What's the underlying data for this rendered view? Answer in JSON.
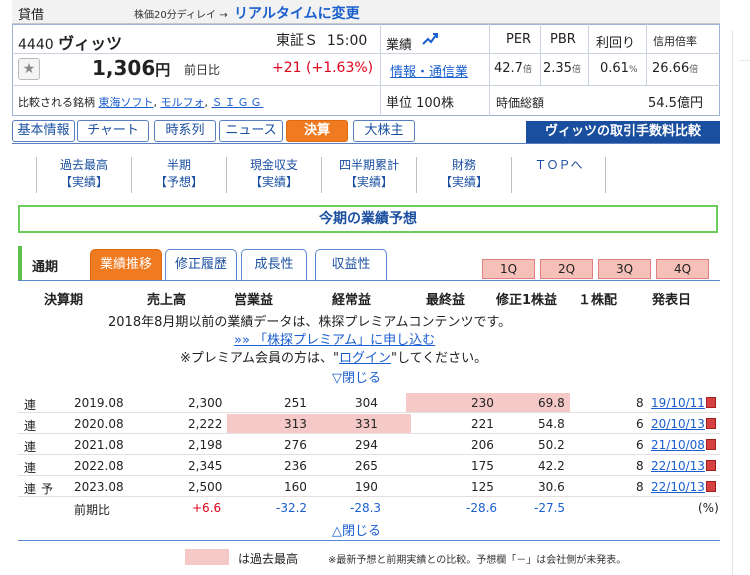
{
  "header": {
    "kashi": "貸借",
    "delay": "株価20分ディレイ →",
    "realtime": "リアルタイムに変更"
  },
  "stock": {
    "code": "4440",
    "name": "ヴィッツ",
    "market": "東証Ｓ",
    "time": "15:00",
    "gyoseki": "業績",
    "price": "1,306",
    "price_unit": "円",
    "zenjitsu_label": "前日比",
    "change": "+21 (+1.63%)",
    "sector": "情報・通信業",
    "compare_label": "比較される銘柄",
    "compare": [
      "東海ソフト",
      "モルフォ",
      "ＳＩＧＧ"
    ],
    "unit": "単位 100株"
  },
  "metrics": {
    "headers": [
      "PER",
      "PBR",
      "利回り",
      "信用倍率"
    ],
    "values": [
      {
        "v": "42.7",
        "u": "倍"
      },
      {
        "v": "2.35",
        "u": "倍"
      },
      {
        "v": "0.61",
        "u": "%"
      },
      {
        "v": "26.66",
        "u": "倍"
      }
    ],
    "jika_label": "時価総額",
    "jika_value": "54.5億円"
  },
  "tabs": [
    "基本情報",
    "チャート",
    "時系列",
    "ニュース",
    "決算",
    "大株主"
  ],
  "broker": "ヴィッツの取引手数料比較",
  "subnav": [
    {
      "a": "過去最高",
      "b": "【実績】"
    },
    {
      "a": "半期",
      "b": "【予想】"
    },
    {
      "a": "現金収支",
      "b": "【実績】"
    },
    {
      "a": "四半期累計",
      "b": "【実績】"
    },
    {
      "a": "財務",
      "b": "【実績】"
    },
    {
      "a": "ＴＯＰへ",
      "b": ""
    }
  ],
  "forecast_title": "今期の業績予想",
  "period": {
    "label": "通期",
    "tabs": [
      "業績推移",
      "修正履歴",
      "成長性",
      "収益性"
    ],
    "quarters": [
      "1Q",
      "2Q",
      "3Q",
      "4Q"
    ]
  },
  "table": {
    "headers": [
      "決算期",
      "売上高",
      "営業益",
      "経常益",
      "最終益",
      "修正1株益",
      "１株配",
      "発表日"
    ],
    "premium_note": "2018年8月期以前の業績データは、株探プレミアムコンテンツです。",
    "premium_link": "»» 「株探プレミアム」に申し込む",
    "login_pre": "※プレミアム会員の方は、\"",
    "login_link": "ログイン",
    "login_post": "\"してください。",
    "close_top": "▽閉じる",
    "close_bottom": "△閉じる",
    "rows": [
      {
        "ren": "連",
        "yo": "",
        "period": "2019.08",
        "sales": "2,300",
        "op": "251",
        "ord": "304",
        "net": "230",
        "eps": "69.8",
        "div": "8",
        "date": "19/10/11"
      },
      {
        "ren": "連",
        "yo": "",
        "period": "2020.08",
        "sales": "2,222",
        "op": "313",
        "ord": "331",
        "net": "221",
        "eps": "54.8",
        "div": "6",
        "date": "20/10/13"
      },
      {
        "ren": "連",
        "yo": "",
        "period": "2021.08",
        "sales": "2,198",
        "op": "276",
        "ord": "294",
        "net": "206",
        "eps": "50.2",
        "div": "6",
        "date": "21/10/08"
      },
      {
        "ren": "連",
        "yo": "",
        "period": "2022.08",
        "sales": "2,345",
        "op": "236",
        "ord": "265",
        "net": "175",
        "eps": "42.2",
        "div": "8",
        "date": "22/10/13"
      },
      {
        "ren": "連",
        "yo": "予",
        "period": "2023.08",
        "sales": "2,500",
        "op": "160",
        "ord": "190",
        "net": "125",
        "eps": "30.6",
        "div": "8",
        "date": "22/10/13"
      }
    ],
    "ratio": {
      "label": "前期比",
      "sales": "+6.6",
      "op": "-32.2",
      "ord": "-28.3",
      "net": "-28.6",
      "eps": "-27.5",
      "unit": "(%)"
    },
    "colors": {
      "positive": "#e0001b",
      "negative": "#1a5fd0",
      "highlight": "#f6c9c9"
    }
  },
  "legend": {
    "text": "は過去最高",
    "footnote": "※最新予想と前期実績との比較。予想欄「－」は会社側が未発表。"
  }
}
